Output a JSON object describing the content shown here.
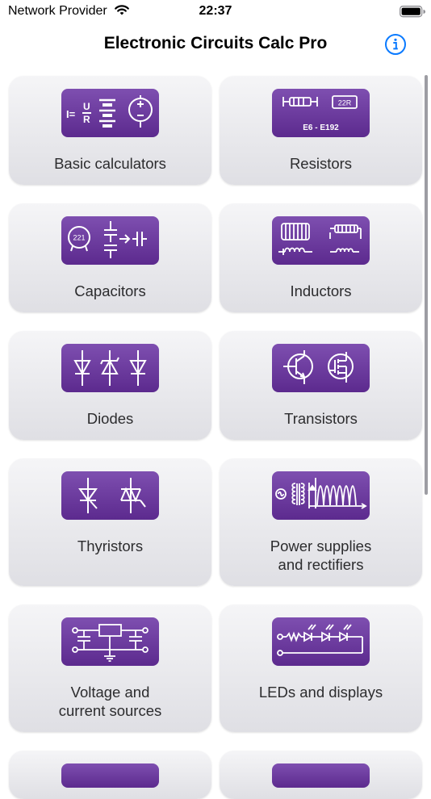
{
  "status_bar": {
    "carrier": "Network Provider",
    "time": "22:37"
  },
  "header": {
    "title": "Electronic Circuits Calc Pro"
  },
  "tiles": [
    {
      "label": "Basic calculators",
      "icon": "ohms-law-battery-icon"
    },
    {
      "label": "Resistors",
      "icon": "resistor-icon",
      "badge_text": "E6 - E192",
      "badge_chip": "22R"
    },
    {
      "label": "Capacitors",
      "icon": "capacitor-icon",
      "badge_chip": "221"
    },
    {
      "label": "Inductors",
      "icon": "inductor-icon"
    },
    {
      "label": "Diodes",
      "icon": "diode-icon"
    },
    {
      "label": "Transistors",
      "icon": "transistor-icon"
    },
    {
      "label": "Thyristors",
      "icon": "thyristor-icon"
    },
    {
      "label_line1": "Power supplies",
      "label_line2": "and rectifiers",
      "icon": "power-supply-icon"
    },
    {
      "label_line1": "Voltage and",
      "label_line2": "current sources",
      "icon": "voltage-source-icon"
    },
    {
      "label": "LEDs and displays",
      "icon": "led-icon"
    }
  ],
  "colors": {
    "accent": "#0a7aff",
    "badge_top": "#7e4fb0",
    "badge_bottom": "#5c2a8e",
    "tile_top": "#f5f5f7",
    "tile_bottom": "#dfdfe4"
  }
}
